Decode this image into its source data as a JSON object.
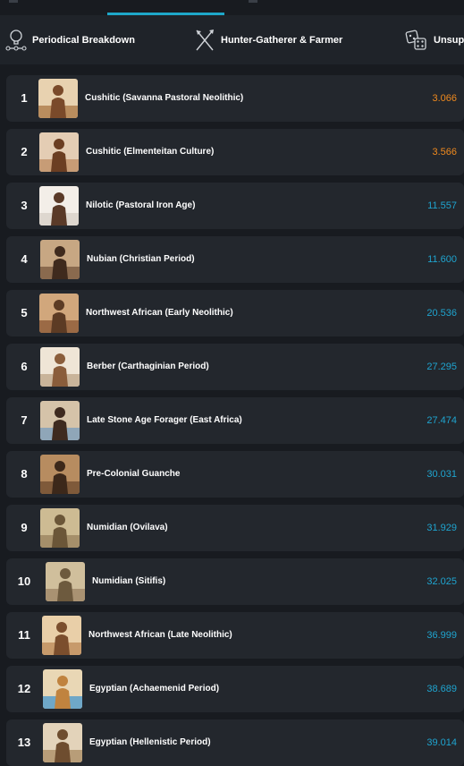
{
  "tabs": [
    {
      "label": "Periodical Breakdown",
      "icon": "timeline-bulb-icon"
    },
    {
      "label": "Hunter-Gatherer & Farmer",
      "icon": "spear-icon"
    },
    {
      "label": "Unsup",
      "icon": "dice-icon"
    }
  ],
  "colors": {
    "accent": "#1ea7c9",
    "distance": "#1fa4cf",
    "distance_warn": "#f08a1e",
    "row_bg": "#23272d",
    "page_bg": "#181b20"
  },
  "results": [
    {
      "rank": "1",
      "name": "Cushitic (Savanna Pastoral Neolithic)",
      "distance": "3.066",
      "highlight": true
    },
    {
      "rank": "2",
      "name": "Cushitic (Elmenteitan Culture)",
      "distance": "3.566",
      "highlight": true
    },
    {
      "rank": "3",
      "name": "Nilotic (Pastoral Iron Age)",
      "distance": "11.557",
      "highlight": false
    },
    {
      "rank": "4",
      "name": "Nubian (Christian Period)",
      "distance": "11.600",
      "highlight": false
    },
    {
      "rank": "5",
      "name": "Northwest African (Early Neolithic)",
      "distance": "20.536",
      "highlight": false
    },
    {
      "rank": "6",
      "name": "Berber (Carthaginian Period)",
      "distance": "27.295",
      "highlight": false
    },
    {
      "rank": "7",
      "name": "Late Stone Age Forager (East Africa)",
      "distance": "27.474",
      "highlight": false
    },
    {
      "rank": "8",
      "name": "Pre-Colonial Guanche",
      "distance": "30.031",
      "highlight": false
    },
    {
      "rank": "9",
      "name": "Numidian (Ovilava)",
      "distance": "31.929",
      "highlight": false
    },
    {
      "rank": "10",
      "name": "Numidian (Sitifis)",
      "distance": "32.025",
      "highlight": false
    },
    {
      "rank": "11",
      "name": "Northwest African (Late Neolithic)",
      "distance": "36.999",
      "highlight": false
    },
    {
      "rank": "12",
      "name": "Egyptian (Achaemenid Period)",
      "distance": "38.689",
      "highlight": false
    },
    {
      "rank": "13",
      "name": "Egyptian (Hellenistic Period)",
      "distance": "39.014",
      "highlight": false
    }
  ]
}
